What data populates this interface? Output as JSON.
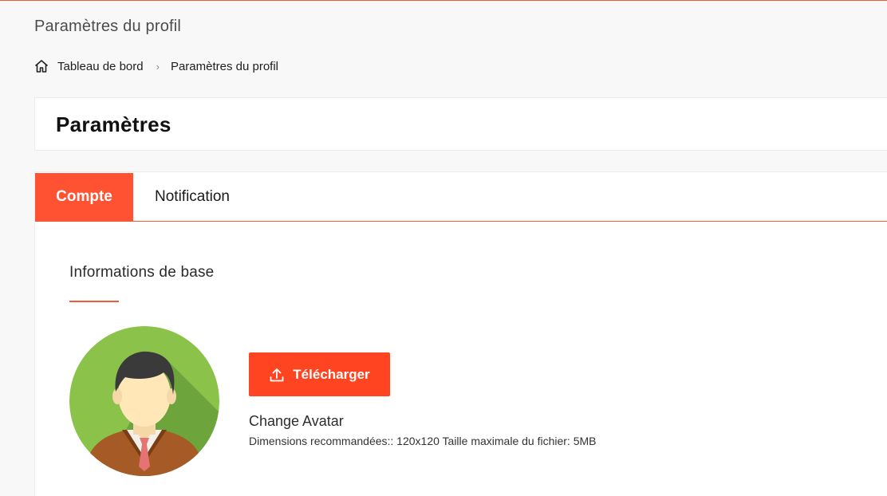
{
  "page": {
    "heading": "Paramètres du profil"
  },
  "breadcrumb": {
    "home_icon": "home-icon",
    "items": [
      "Tableau de bord",
      "Paramètres du profil"
    ],
    "separator": "›"
  },
  "title_card": {
    "title": "Paramètres"
  },
  "tabs": [
    {
      "label": "Compte",
      "active": true
    },
    {
      "label": "Notification",
      "active": false
    }
  ],
  "basic_info": {
    "title": "Informations de base",
    "upload_button_label": "Télécharger",
    "upload_icon": "upload-icon",
    "avatar_caption": "Change Avatar",
    "avatar_hint": "Dimensions recommandées:: 120x120 Taille maximale du fichier: 5MB"
  },
  "colors": {
    "accent": "#ff5233",
    "accent_line": "#f05a3a",
    "avatar_bg": "#8bc34a"
  }
}
